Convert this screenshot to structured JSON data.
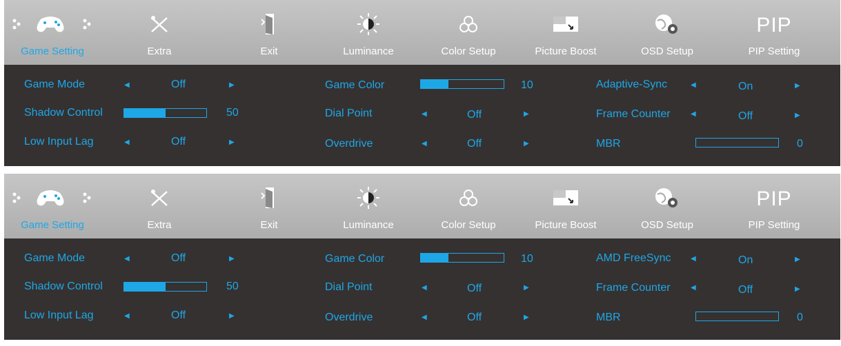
{
  "tabs": [
    {
      "label": "Game Setting",
      "icon": "gamepad-icon",
      "active": true
    },
    {
      "label": "Extra",
      "icon": "tools-icon"
    },
    {
      "label": "Exit",
      "icon": "exit-door-icon"
    },
    {
      "label": "Luminance",
      "icon": "sun-icon"
    },
    {
      "label": "Color Setup",
      "icon": "color-circles-icon"
    },
    {
      "label": "Picture Boost",
      "icon": "picture-boost-icon"
    },
    {
      "label": "OSD Setup",
      "icon": "osd-gear-icon"
    },
    {
      "label": "PIP Setting",
      "icon": "pip-icon",
      "icon_text": "PIP"
    }
  ],
  "panels": [
    {
      "game_mode": {
        "label": "Game Mode",
        "value": "Off"
      },
      "shadow_control": {
        "label": "Shadow Control",
        "value": "50",
        "level": 50
      },
      "low_input_lag": {
        "label": "Low Input Lag",
        "value": "Off"
      },
      "game_color": {
        "label": "Game Color",
        "value": "10",
        "level": 10
      },
      "dial_point": {
        "label": "Dial Point",
        "value": "Off"
      },
      "overdrive": {
        "label": "Overdrive",
        "value": "Off"
      },
      "sync": {
        "label": "Adaptive-Sync",
        "value": "On"
      },
      "frame_counter": {
        "label": "Frame Counter",
        "value": "Off"
      },
      "mbr": {
        "label": "MBR",
        "value": "0",
        "level": 0
      }
    },
    {
      "game_mode": {
        "label": "Game Mode",
        "value": "Off"
      },
      "shadow_control": {
        "label": "Shadow Control",
        "value": "50",
        "level": 50
      },
      "low_input_lag": {
        "label": "Low Input Lag",
        "value": "Off"
      },
      "game_color": {
        "label": "Game Color",
        "value": "10",
        "level": 10
      },
      "dial_point": {
        "label": "Dial Point",
        "value": "Off"
      },
      "overdrive": {
        "label": "Overdrive",
        "value": "Off"
      },
      "sync": {
        "label": "AMD FreeSync",
        "value": "On"
      },
      "frame_counter": {
        "label": "Frame Counter",
        "value": "Off"
      },
      "mbr": {
        "label": "MBR",
        "value": "0",
        "level": 0
      }
    }
  ],
  "colors": {
    "accent": "#1ea7e6",
    "panel": "#353131",
    "menubar": "#b8b8b8"
  }
}
